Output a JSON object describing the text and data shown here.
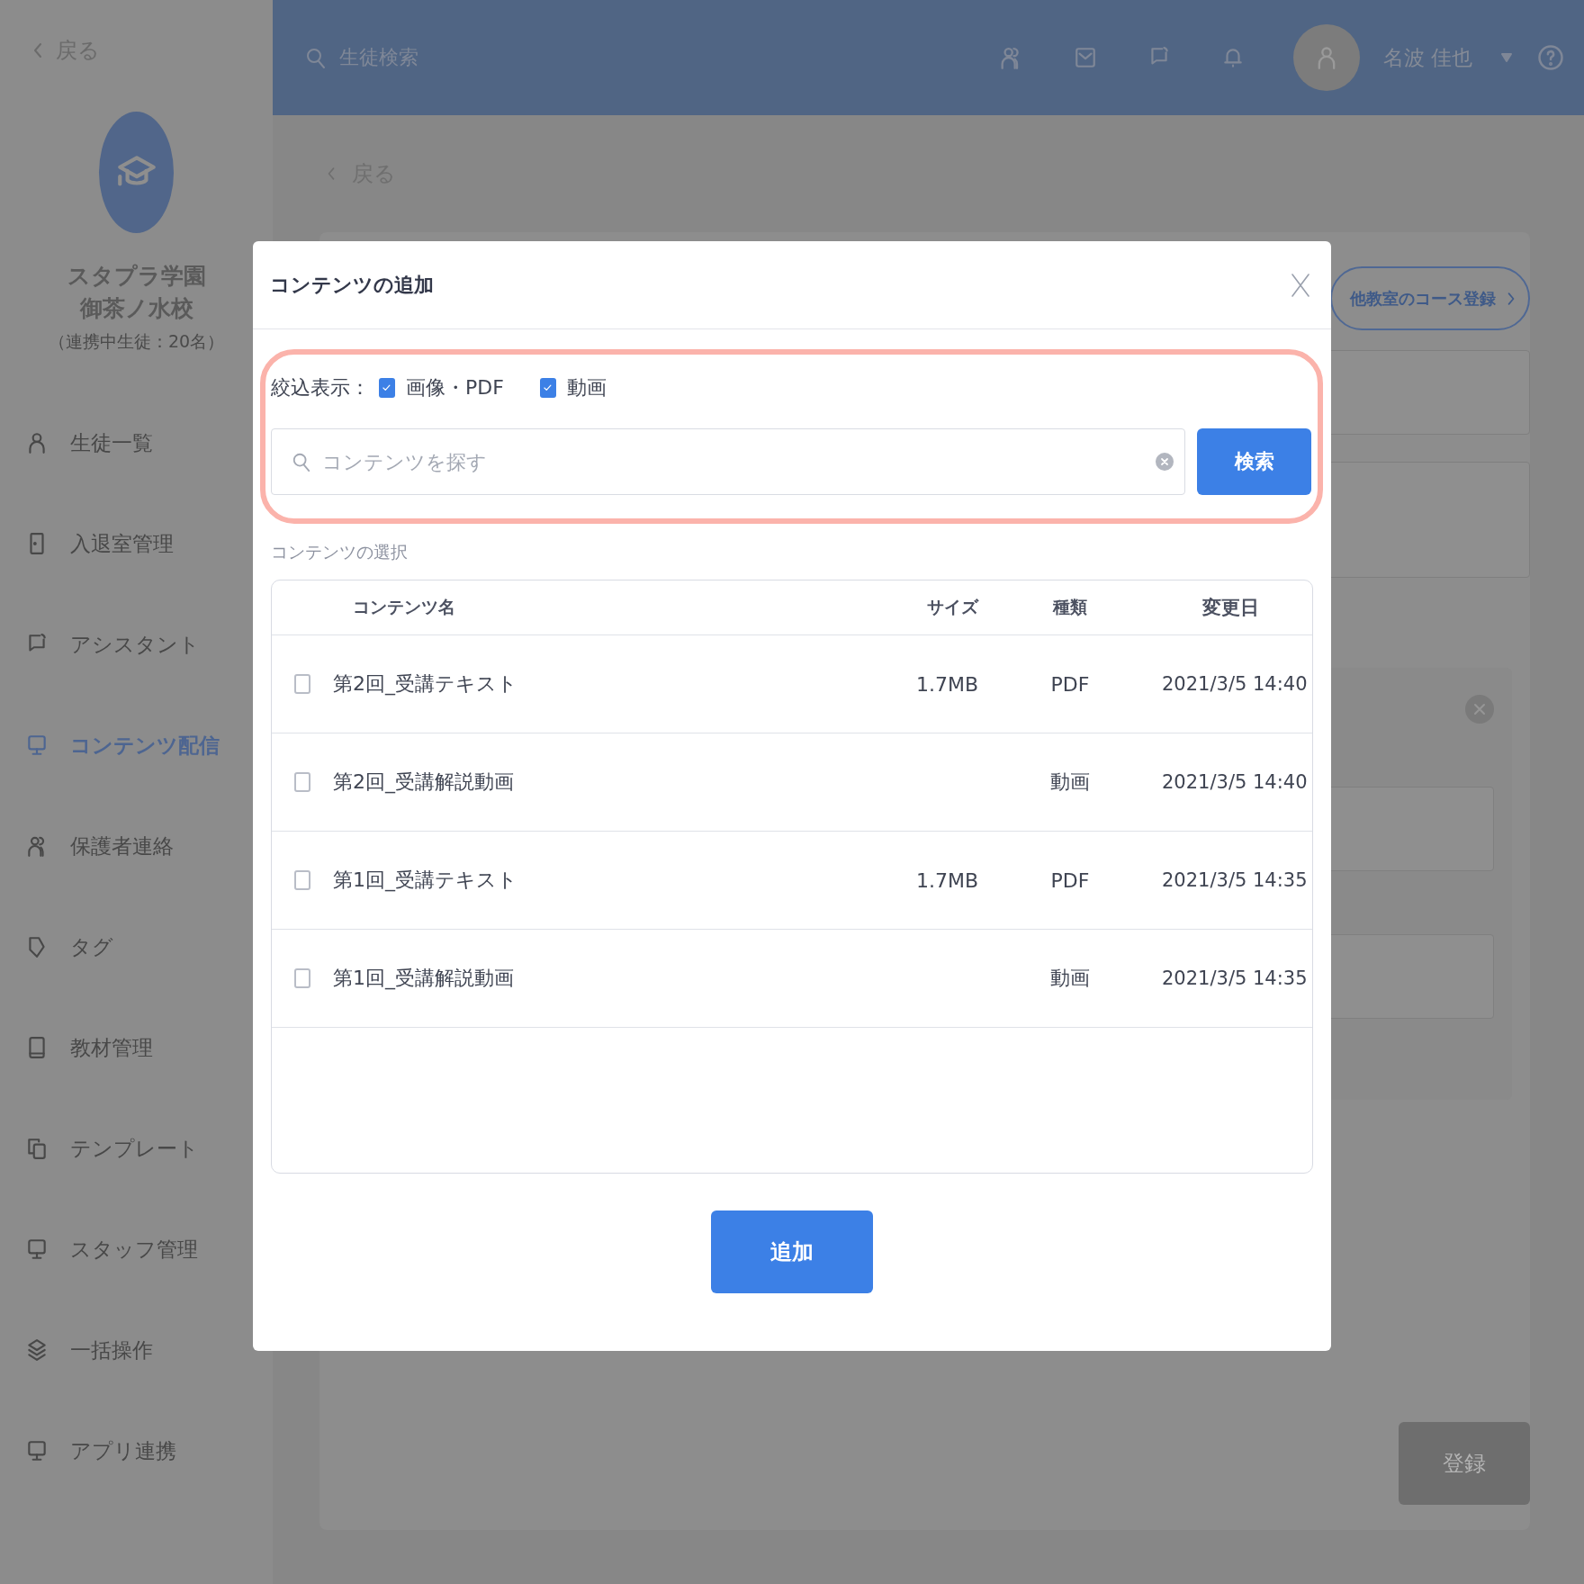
{
  "sidebar": {
    "back": "戻る",
    "school_name": [
      "スタプラ学園",
      "御茶ノ水校"
    ],
    "student_count": "（連携中生徒：20名）",
    "items": [
      {
        "label": "生徒一覧",
        "selected": false
      },
      {
        "label": "入退室管理",
        "selected": false
      },
      {
        "label": "アシスタント",
        "selected": false
      },
      {
        "label": "コンテンツ配信",
        "selected": true
      },
      {
        "label": "保護者連絡",
        "selected": false
      },
      {
        "label": "タグ",
        "selected": false
      },
      {
        "label": "教材管理",
        "selected": false
      },
      {
        "label": "テンプレート",
        "selected": false
      },
      {
        "label": "スタッフ管理",
        "selected": false
      },
      {
        "label": "一括操作",
        "selected": false
      },
      {
        "label": "アプリ連携",
        "selected": false
      }
    ]
  },
  "header": {
    "search_placeholder": "生徒検索",
    "user_name": "名波 佳也"
  },
  "page": {
    "back": "戻る",
    "course_button": "他教室のコース登録",
    "register_button": {
      "label": "登録",
      "disabled": true
    }
  },
  "modal": {
    "title": "コンテンツの追加",
    "filter": {
      "label": "絞込表示：",
      "options": [
        {
          "label": "画像・PDF",
          "checked": true
        },
        {
          "label": "動画",
          "checked": true
        }
      ]
    },
    "search": {
      "placeholder": "コンテンツを探す",
      "button": "検索"
    },
    "section_label": "コンテンツの選択",
    "table": {
      "columns": [
        "コンテンツ名",
        "サイズ",
        "種類",
        "変更日"
      ],
      "rows": [
        {
          "checked": false,
          "name": "第2回_受講テキスト",
          "size": "1.7MB",
          "type": "PDF",
          "date": "2021/3/5 14:40"
        },
        {
          "checked": false,
          "name": "第2回_受講解説動画",
          "type": "動画",
          "date": "2021/3/5 14:40"
        },
        {
          "checked": false,
          "name": "第1回_受講テキスト",
          "size": "1.7MB",
          "type": "PDF",
          "date": "2021/3/5 14:35"
        },
        {
          "checked": false,
          "name": "第1回_受講解説動画",
          "type": "動画",
          "date": "2021/3/5 14:35"
        }
      ]
    },
    "add_button": "追加"
  }
}
